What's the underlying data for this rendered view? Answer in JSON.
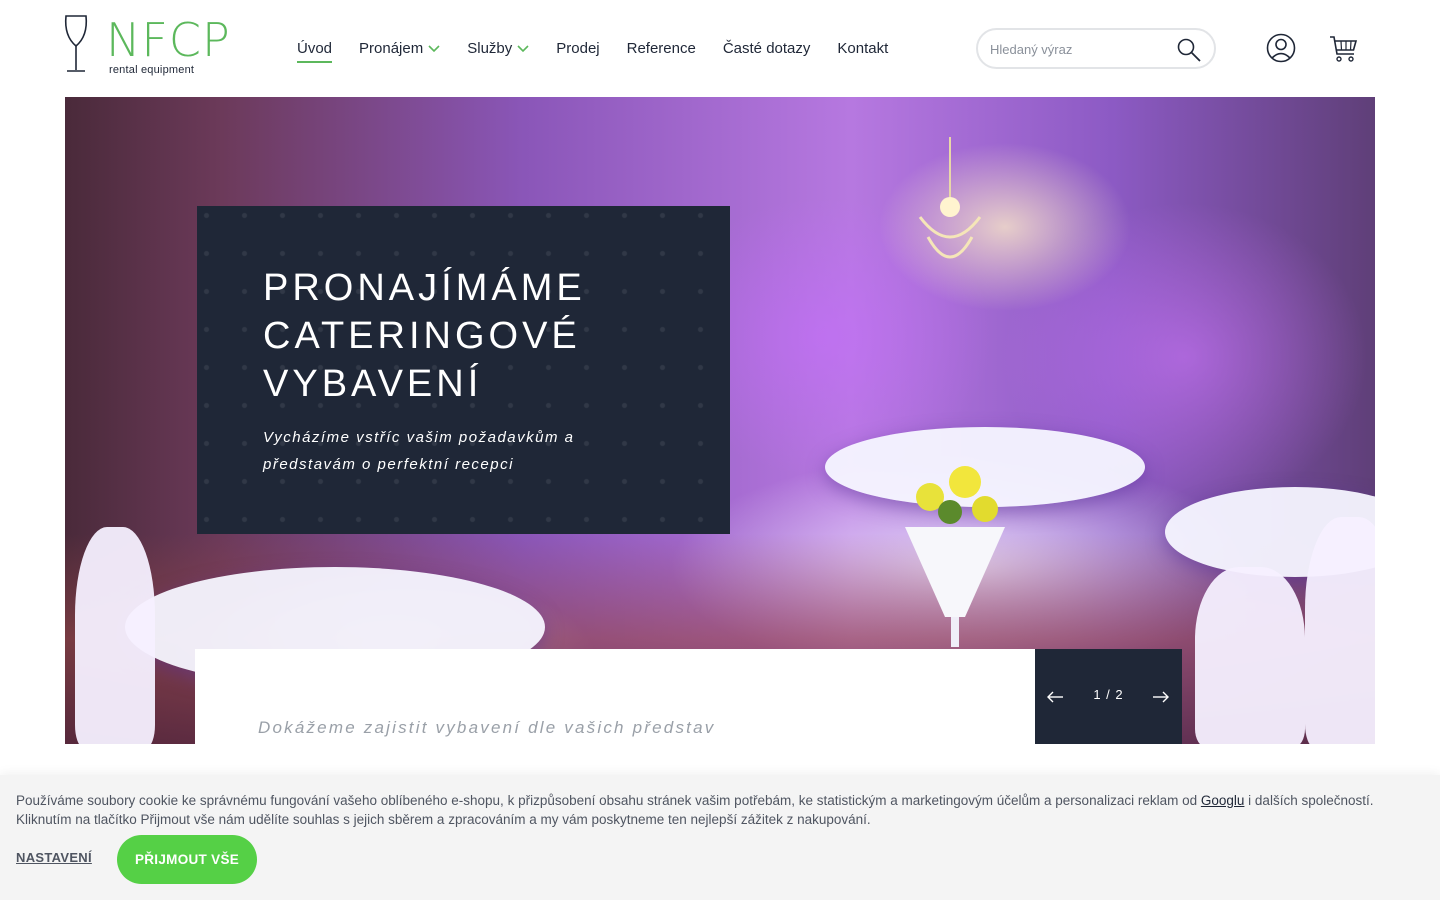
{
  "header": {
    "logo": {
      "text": "NFCP",
      "subtitle": "rental equipment",
      "icon": "wine-glass-icon"
    },
    "nav": [
      {
        "label": "Úvod",
        "active": true,
        "dropdown": false
      },
      {
        "label": "Pronájem",
        "active": false,
        "dropdown": true
      },
      {
        "label": "Služby",
        "active": false,
        "dropdown": true
      },
      {
        "label": "Prodej",
        "active": false,
        "dropdown": false
      },
      {
        "label": "Reference",
        "active": false,
        "dropdown": false
      },
      {
        "label": "Časté dotazy",
        "active": false,
        "dropdown": false
      },
      {
        "label": "Kontakt",
        "active": false,
        "dropdown": false
      }
    ],
    "search": {
      "placeholder": "Hledaný výraz",
      "value": "",
      "icon": "search-icon"
    },
    "icons": {
      "user": "user-icon",
      "cart": "cart-icon"
    }
  },
  "hero": {
    "title": "PRONAJÍMÁME CATERINGOVÉ VYBAVENÍ",
    "subtitle": "Vycházíme vstříc vašim požadavkům a představám o perfektní recepci",
    "caption": "Dokážeme zajistit vybavení dle vašich představ",
    "slider": {
      "counter": "1 / 2",
      "prev_icon": "arrow-left-icon",
      "next_icon": "arrow-right-icon"
    }
  },
  "cookie": {
    "text_before": "Používáme soubory cookie ke správnému fungování vašeho oblíbeného e-shopu, k přizpůsobení obsahu stránek vašim potřebám, ke statistickým a marketingovým účelům a personalizaci reklam od ",
    "link": "Googlu",
    "text_after": " i dalších společností. Kliknutím na tlačítko Přijmout vše nám udělíte souhlas s jejich sběrem a zpracováním a my vám poskytneme ten nejlepší zážitek z nakupování.",
    "settings_label": "NASTAVENÍ",
    "accept_label": "PŘIJMOUT VŠE"
  },
  "colors": {
    "accent": "#5cb85c",
    "dark": "#1f2737",
    "accept": "#55d046"
  }
}
